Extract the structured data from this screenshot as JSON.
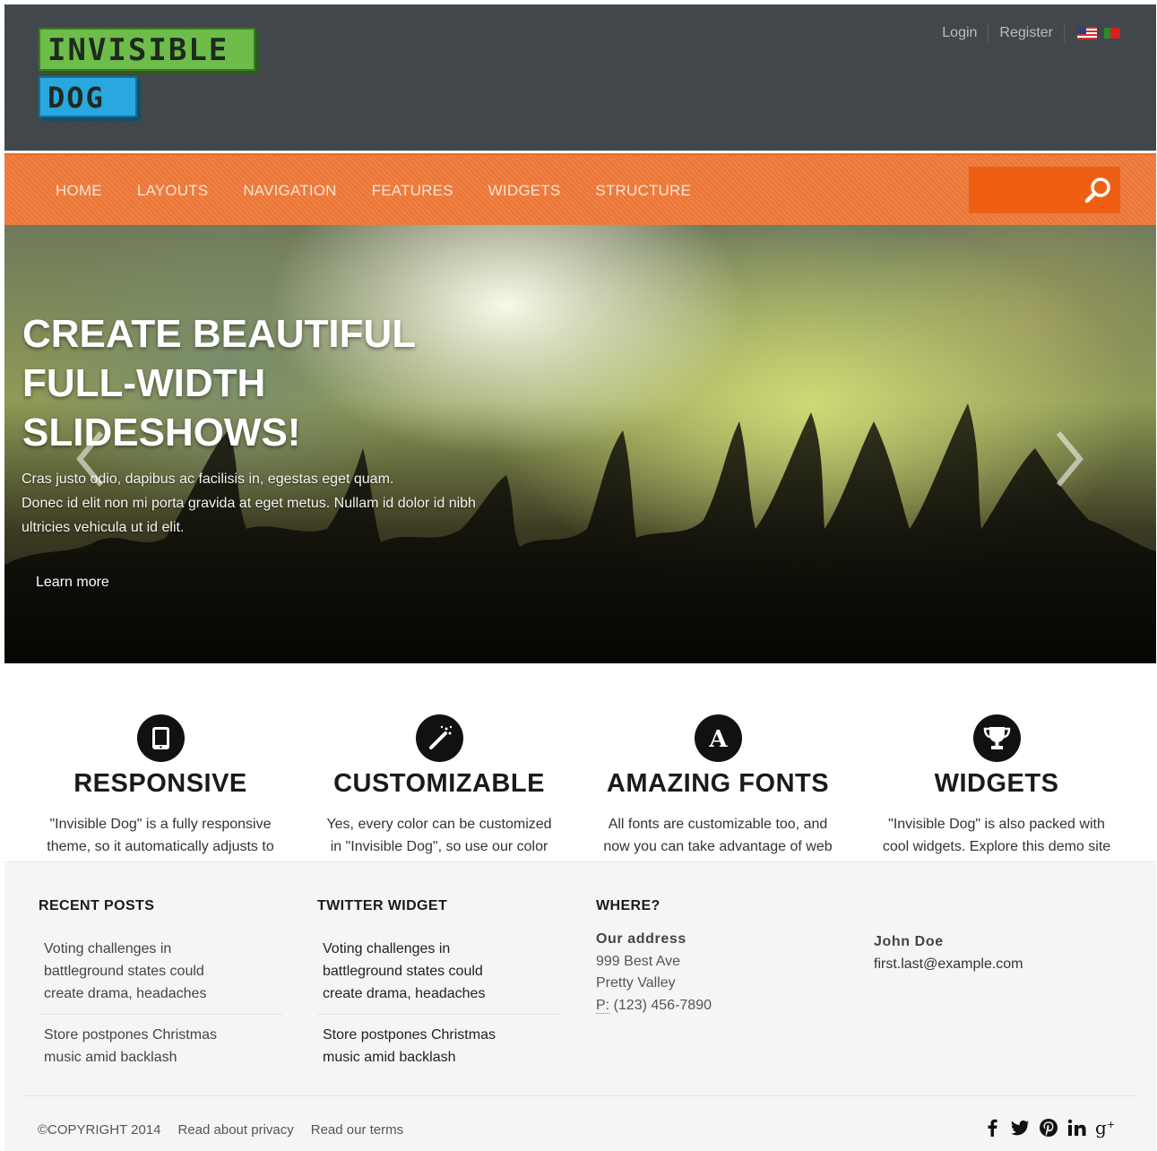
{
  "header": {
    "logo": {
      "line1": "INVISIBLE",
      "line2": "DOG"
    },
    "login_label": "Login",
    "register_label": "Register",
    "flags": [
      "us-flag-icon",
      "pt-flag-icon"
    ]
  },
  "nav": {
    "items": [
      "HOME",
      "LAYOUTS",
      "NAVIGATION",
      "FEATURES",
      "WIDGETS",
      "STRUCTURE"
    ],
    "search_icon": "search-icon"
  },
  "hero": {
    "title_lines": [
      "CREATE BEAUTIFUL",
      "FULL-WIDTH",
      "SLIDESHOWS!"
    ],
    "text_lines": [
      "Cras justo odio, dapibus ac facilisis in, egestas eget quam.",
      "Donec id elit non mi porta gravida at eget metus. Nullam id dolor id nibh",
      "ultricies vehicula ut id elit."
    ],
    "cta_label": "Learn more"
  },
  "features": [
    {
      "icon": "tablet-icon",
      "title": "RESPONSIVE",
      "desc": "\"Invisible Dog\" is a fully responsive theme, so it automatically adjusts to any"
    },
    {
      "icon": "magic-wand-icon",
      "title": "CUSTOMIZABLE",
      "desc": "Yes, every color can be customized in \"Invisible Dog\", so use our color pickers to choose"
    },
    {
      "icon": "font-icon",
      "title": "AMAZING FONTS",
      "desc": "All fonts are customizable too, and now you can take advantage of web fonts with hundreds of"
    },
    {
      "icon": "trophy-icon",
      "title": "WIDGETS",
      "desc": "\"Invisible Dog\" is also packed with cool widgets. Explore this demo site to find all the great features"
    }
  ],
  "footer": {
    "recent_posts": {
      "heading": "RECENT POSTS",
      "posts": [
        [
          "Voting challenges in",
          "battleground states could",
          "create drama, headaches"
        ],
        [
          "Store postpones Christmas",
          "music amid backlash"
        ]
      ]
    },
    "twitter": {
      "heading": "TWITTER WIDGET",
      "posts": [
        [
          "Voting challenges in",
          "battleground states could",
          "create drama, headaches"
        ],
        [
          "Store postpones Christmas",
          "music amid backlash"
        ]
      ]
    },
    "where": {
      "heading": "WHERE?",
      "address_label": "Our address",
      "street": "999 Best Ave",
      "city": "Pretty Valley",
      "phone_prefix": "P:",
      "phone": "(123) 456-7890"
    },
    "contact": {
      "name": "John Doe",
      "email": "first.last@example.com"
    },
    "copyright": "©COPYRIGHT 2014",
    "privacy_link": "Read about privacy",
    "terms_link": "Read our terms",
    "socials": [
      {
        "icon": "facebook-icon",
        "glyph": "f"
      },
      {
        "icon": "twitter-icon",
        "glyph": "t"
      },
      {
        "icon": "pinterest-icon",
        "glyph": "p"
      },
      {
        "icon": "linkedin-icon",
        "glyph": "in"
      },
      {
        "icon": "googleplus-icon",
        "glyph": "g+"
      }
    ]
  },
  "colors": {
    "header_bg": "#41464b",
    "nav_bg": "#f07a3a",
    "search_bg": "#ef5f12",
    "logo_green": "#6ebd4a",
    "logo_blue": "#29a8e0"
  }
}
